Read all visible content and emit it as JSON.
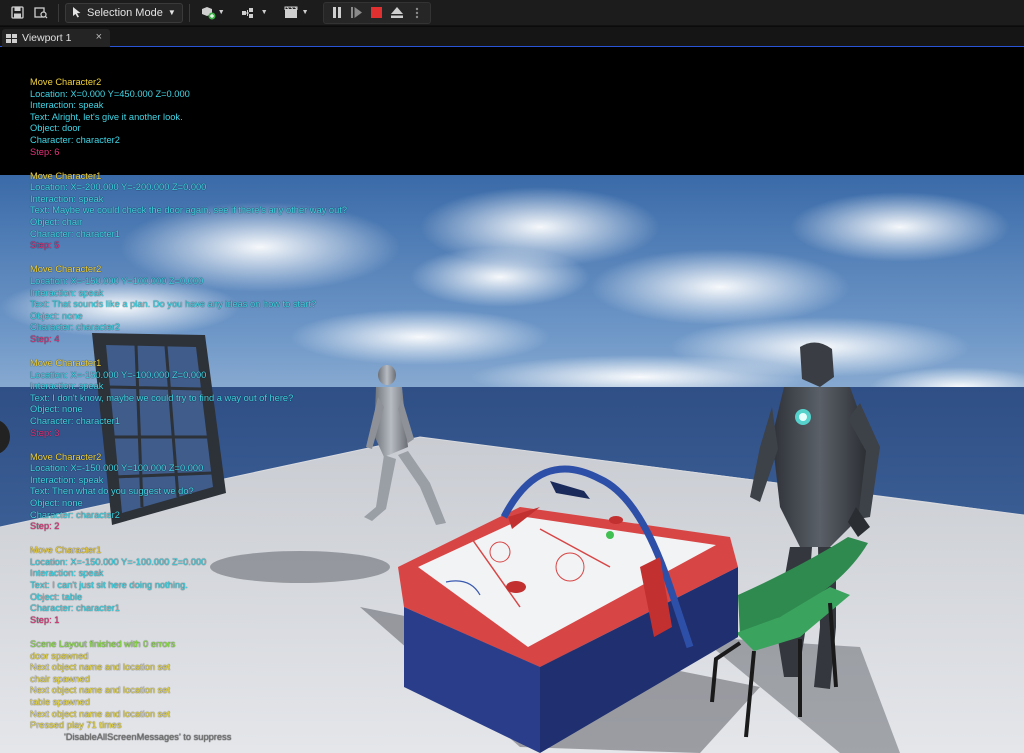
{
  "toolbar": {
    "mode_label": "Selection Mode",
    "icons": [
      "save-icon",
      "browse-icon",
      "add-actor-icon",
      "blueprint-icon",
      "cinematics-icon",
      "pause-icon",
      "step-icon",
      "stop-icon",
      "eject-icon",
      "more-icon"
    ],
    "play_colors": {
      "stop": "#e03030"
    }
  },
  "tab": {
    "label": "Viewport 1",
    "close": "×"
  },
  "log": {
    "blocks": [
      {
        "title": "Move Character2",
        "location": "Location: X=0.000 Y=450.000 Z=0.000",
        "interaction": "Interaction: speak",
        "text": "Text: Alright, let's give it another look.",
        "object": "Object: door",
        "character": "Character: character2",
        "step": "Step: 6"
      },
      {
        "title": "Move Character1",
        "location": "Location: X=-200.000 Y=-200.000 Z=0.000",
        "interaction": "Interaction: speak",
        "text": "Text: Maybe we could check the door again, see if there's any other way out?",
        "object": "Object: chair",
        "character": "Character: character1",
        "step": "Step: 5"
      },
      {
        "title": "Move Character2",
        "location": "Location: X=-150.000 Y=100.000 Z=0.000",
        "interaction": "Interaction: speak",
        "text": "Text: That sounds like a plan. Do you have any ideas on how to start?",
        "object": "Object: none",
        "character": "Character: character2",
        "step": "Step: 4"
      },
      {
        "title": "Move Character1",
        "location": "Location: X=-150.000 Y=-100.000 Z=0.000",
        "interaction": "Interaction: speak",
        "text": "Text: I don't know, maybe we could try to find a way out of here?",
        "object": "Object: none",
        "character": "Character: character1",
        "step": "Step: 3"
      },
      {
        "title": "Move Character2",
        "location": "Location: X=-150.000 Y=100.000 Z=0.000",
        "interaction": "Interaction: speak",
        "text": "Text: Then what do you suggest we do?",
        "object": "Object: none",
        "character": "Character: character2",
        "step": "Step: 2"
      },
      {
        "title": "Move Character1",
        "location": "Location: X=-150.000 Y=-100.000 Z=0.000",
        "interaction": "Interaction: speak",
        "text": "Text: I can't just sit here doing nothing.",
        "object": "Object: table",
        "character": "Character: character1",
        "step": "Step: 1"
      }
    ],
    "status": {
      "scene_layout": "Scene Layout finished with 0 errors",
      "door_spawned": "door spawned",
      "next1": "Next object name and location set",
      "chair_spawned": "chair spawned",
      "next2": "Next object name and location set",
      "table_spawned": "table spawned",
      "next3": "Next object name and location set",
      "pressed": "Pressed play 71 times",
      "suppress": "'DisableAllScreenMessages' to suppress"
    }
  }
}
